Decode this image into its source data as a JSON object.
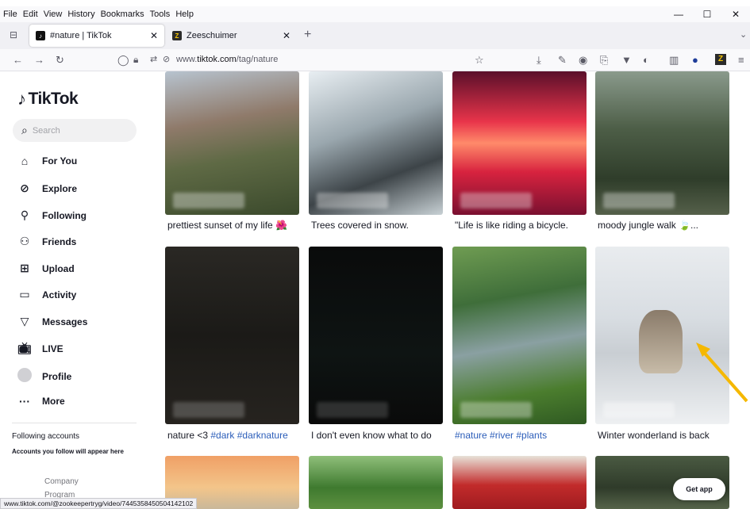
{
  "menu": [
    "File",
    "Edit",
    "View",
    "History",
    "Bookmarks",
    "Tools",
    "Help"
  ],
  "window_controls": {
    "minimize": "—",
    "maximize": "☐",
    "close": "✕"
  },
  "tabs": [
    {
      "title": "#nature | TikTok",
      "close": "✕",
      "icon": "tiktok-icon"
    },
    {
      "title": "Zeeschuimer",
      "close": "✕",
      "icon": "zeeschuimer-icon"
    }
  ],
  "new_tab": "+",
  "url": {
    "domain_prefix": "www.",
    "domain": "tiktok.com",
    "path": "/tag/nature"
  },
  "sidebar": {
    "logo": "TikTok",
    "search_placeholder": "Search",
    "items": [
      {
        "label": "For You",
        "icon": "home-icon"
      },
      {
        "label": "Explore",
        "icon": "compass-icon"
      },
      {
        "label": "Following",
        "icon": "user-plus-icon"
      },
      {
        "label": "Friends",
        "icon": "friends-icon"
      },
      {
        "label": "Upload",
        "icon": "upload-icon"
      },
      {
        "label": "Activity",
        "icon": "activity-icon"
      },
      {
        "label": "Messages",
        "icon": "messages-icon"
      },
      {
        "label": "LIVE",
        "icon": "live-icon"
      },
      {
        "label": "Profile",
        "icon": "avatar-icon"
      },
      {
        "label": "More",
        "icon": "more-icon"
      }
    ],
    "following_title": "Following accounts",
    "following_sub": "Accounts you follow will appear here",
    "footer": [
      "Company",
      "Program"
    ]
  },
  "videos": [
    {
      "caption": "prettiest sunset of my life 🌺",
      "tags": ""
    },
    {
      "caption": "Trees covered in snow.",
      "tags": ""
    },
    {
      "caption": "\"Life is like riding a bicycle.",
      "tags": ""
    },
    {
      "caption": "moody jungle walk 🍃...",
      "tags": ""
    },
    {
      "caption": "nature <3 ",
      "tags": "#dark #darknature"
    },
    {
      "caption": "I don't even know what to do",
      "tags": ""
    },
    {
      "caption": "",
      "tags": "#nature #river #plants"
    },
    {
      "caption": "Winter wonderland is back",
      "tags": ""
    }
  ],
  "get_app": "Get app",
  "status_url": "www.tiktok.com/@zookeepertryg/video/7445358450504142102",
  "colors": {
    "accent": "#fe2c55",
    "hashtag": "#2b5db9",
    "annotation_arrow": "#f5b800"
  }
}
